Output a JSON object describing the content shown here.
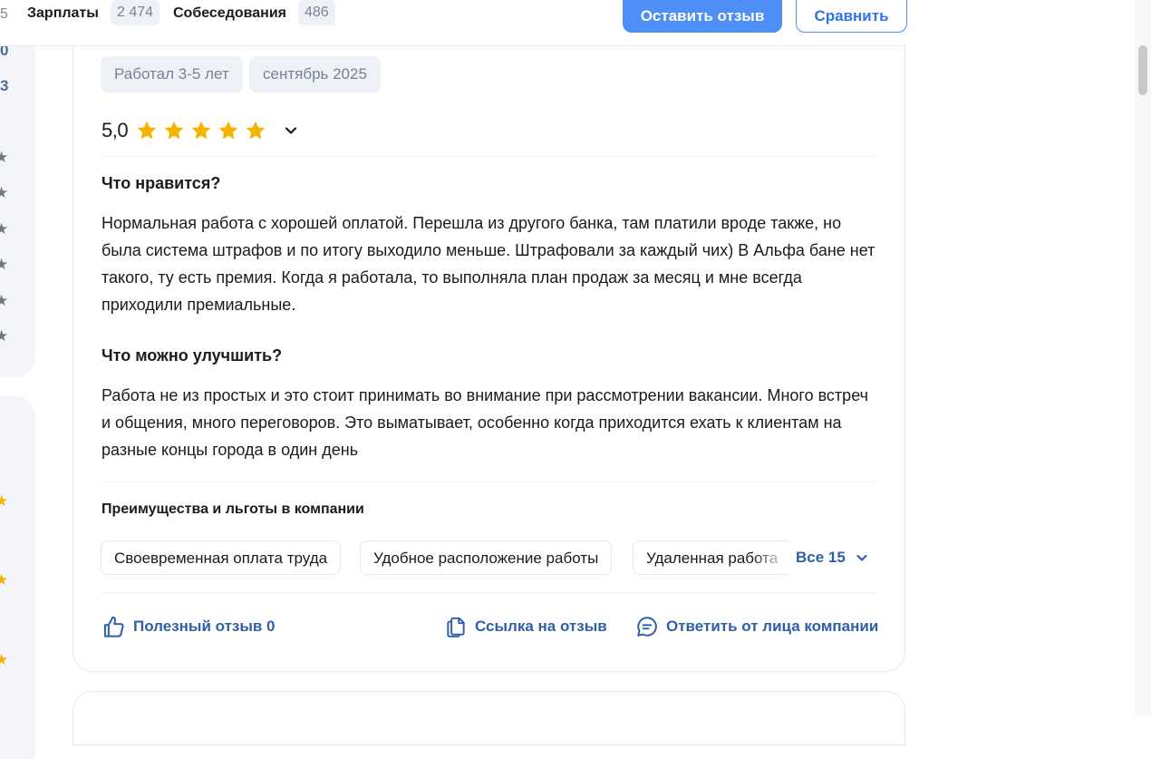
{
  "topbar": {
    "cut_count": "5",
    "tabs": [
      {
        "label": "Зарплаты",
        "count": "2 474"
      },
      {
        "label": "Собеседования",
        "count": "486"
      }
    ],
    "leave_review_button": "Оставить отзыв",
    "compare_button": "Сравнить"
  },
  "sidebar": {
    "numbers": [
      "0",
      "3"
    ],
    "star_glyph": "★",
    "accent_color": "#f4b400"
  },
  "review": {
    "tags": [
      "Работал 3-5 лет",
      "сентябрь 2025"
    ],
    "rating_value": "5,0",
    "stars": 5,
    "likes_title": "Что нравится?",
    "likes_text": "Нормальная работа с хорошей оплатой. Перешла из другого банка, там платили вроде также, но была система штрафов и по итогу выходило меньше. Штрафовали за каждый чих) В Альфа бане нет такого, ту есть премия. Когда я работала, то выполняла план продаж за месяц и мне всегда приходили премиальные.",
    "improve_title": "Что можно улучшить?",
    "improve_text": "Работа не из простых и это стоит принимать во внимание при рассмотрении вакансии. Много встреч и общения, много переговоров. Это выматывает, особенно когда приходится ехать к клиентам на разные концы города в один день",
    "benefits_title": "Преимущества и льготы в компании",
    "benefits": [
      "Своевременная оплата труда",
      "Удобное расположение работы",
      "Удаленная работа"
    ],
    "benefits_more": "Все 15",
    "actions": {
      "helpful": "Полезный отзыв 0",
      "link": "Ссылка на отзыв",
      "reply": "Ответить от лица компании"
    }
  },
  "colors": {
    "primary": "#4d8ef7",
    "link": "#2f5fa8",
    "star": "#f4b400"
  }
}
